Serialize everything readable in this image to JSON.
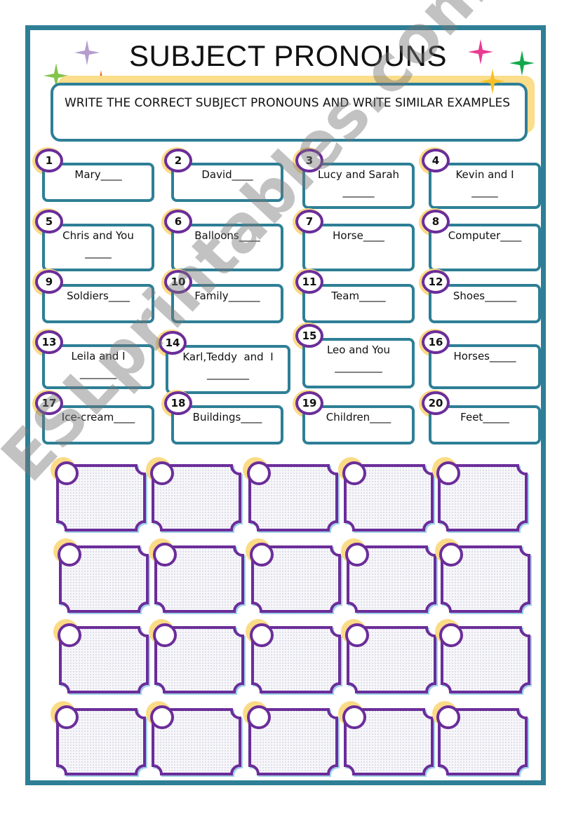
{
  "worksheet": {
    "title": "SUBJECT PRONOUNS",
    "instruction": "WRITE THE CORRECT SUBJECT PRONOUNS AND WRITE SIMILAR EXAMPLES",
    "watermark": "ESLprintables.com"
  },
  "items": [
    {
      "number": "1",
      "text": "Mary____",
      "line2": ""
    },
    {
      "number": "2",
      "text": "David____",
      "line2": ""
    },
    {
      "number": "3",
      "text": "Lucy and Sarah",
      "line2": "______"
    },
    {
      "number": "4",
      "text": "Kevin and I",
      "line2": "_____"
    },
    {
      "number": "5",
      "text": "Chris and You",
      "line2": "_____"
    },
    {
      "number": "6",
      "text": "Balloons____",
      "line2": ""
    },
    {
      "number": "7",
      "text": "Horse____",
      "line2": ""
    },
    {
      "number": "8",
      "text": "Computer____",
      "line2": ""
    },
    {
      "number": "9",
      "text": "Soldiers____",
      "line2": ""
    },
    {
      "number": "10",
      "text": "Family______",
      "line2": ""
    },
    {
      "number": "11",
      "text": "Team_____",
      "line2": ""
    },
    {
      "number": "12",
      "text": "Shoes______",
      "line2": ""
    },
    {
      "number": "13",
      "text": "Leila and I",
      "line2": "_______"
    },
    {
      "number": "14",
      "text": "Karl,Teddy  and  I",
      "line2": "________"
    },
    {
      "number": "15",
      "text": "Leo and You",
      "line2": "_________"
    },
    {
      "number": "16",
      "text": "Horses_____",
      "line2": ""
    },
    {
      "number": "17",
      "text": "Ice-cream____",
      "line2": ""
    },
    {
      "number": "18",
      "text": "Buildings____",
      "line2": ""
    },
    {
      "number": "19",
      "text": "Children____",
      "line2": ""
    },
    {
      "number": "20",
      "text": "Feet_____",
      "line2": ""
    }
  ],
  "answer_boxes": {
    "rows": 4,
    "columns": 5
  },
  "colors": {
    "frame": "#2e7f96",
    "circle": "#6b2d9a",
    "highlight": "#fbdb86",
    "box_shadow": "#9fd0e8"
  }
}
